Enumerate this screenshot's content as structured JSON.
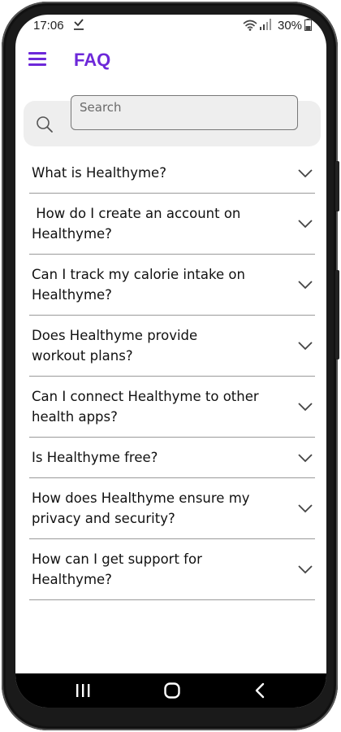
{
  "status_bar": {
    "time": "17:06",
    "battery": "30%"
  },
  "header": {
    "title": "FAQ",
    "menu_icon": "menu-icon",
    "accent_color": "#6d28d9"
  },
  "search": {
    "placeholder": "Search",
    "icon": "search-icon"
  },
  "faq": {
    "items": [
      {
        "question": "What is Healthyme?"
      },
      {
        "question": " How do I create an account on Healthyme?"
      },
      {
        "question": "Can I track my calorie intake on Healthyme?"
      },
      {
        "question": "Does Healthyme provide workout plans?"
      },
      {
        "question": "Can I connect Healthyme to other health apps?"
      },
      {
        "question": "Is Healthyme free?"
      },
      {
        "question": "How does Healthyme ensure my privacy and security?"
      },
      {
        "question": "How can I get support for Healthyme?"
      }
    ]
  },
  "nav_bar": {
    "recents_icon": "recents-icon",
    "home_icon": "home-icon",
    "back_icon": "back-icon"
  }
}
